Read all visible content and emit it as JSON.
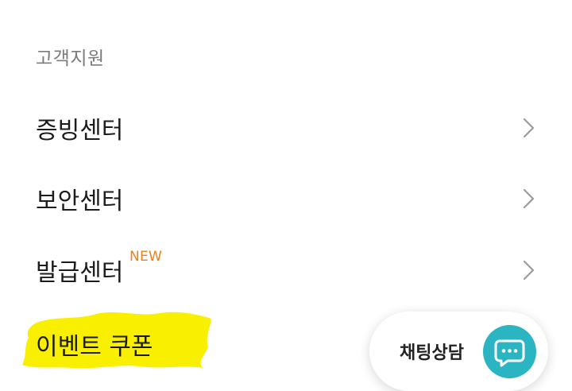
{
  "section": {
    "title": "고객지원"
  },
  "menu": {
    "items": [
      {
        "label": "증빙센터"
      },
      {
        "label": "보안센터"
      },
      {
        "label": "발급센터",
        "badge": "NEW"
      }
    ]
  },
  "coupon": {
    "label": "이벤트 쿠폰",
    "highlight_color": "#f8f000"
  },
  "chat": {
    "label": "채팅상담",
    "icon": "chat-bubble-icon",
    "accent_color": "#2bb5c3"
  },
  "colors": {
    "new_badge": "#e8811a",
    "chevron": "#9a9a9a"
  }
}
